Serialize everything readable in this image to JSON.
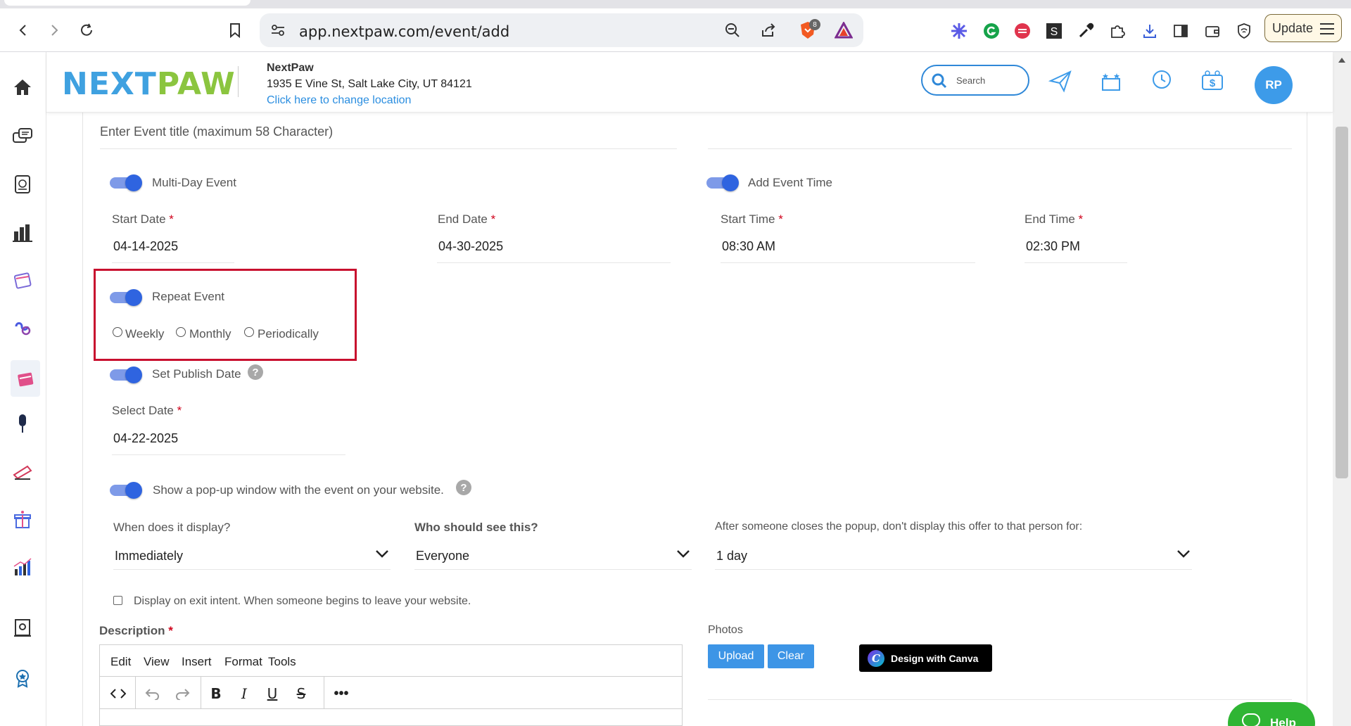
{
  "browser": {
    "url": "app.nextpaw.com/event/add",
    "update_label": "Update",
    "brave_badge": "8"
  },
  "header": {
    "logo_part1": "NEXT",
    "logo_part2": "PAW",
    "business_name": "NextPaw",
    "address": "1935 E Vine St, Salt Lake City, UT 84121",
    "change_location": "Click here to change location",
    "search_placeholder": "Search",
    "avatar_initials": "RP"
  },
  "form": {
    "title_placeholder": "Enter Event title (maximum 58 Character)",
    "multi_day_label": "Multi-Day Event",
    "add_time_label": "Add Event Time",
    "start_date_label": "Start Date",
    "start_date": "04-14-2025",
    "end_date_label": "End Date",
    "end_date": "04-30-2025",
    "start_time_label": "Start Time",
    "start_time": "08:30 AM",
    "end_time_label": "End Time",
    "end_time": "02:30 PM",
    "repeat_label": "Repeat Event",
    "repeat_options": [
      "Weekly",
      "Monthly",
      "Periodically"
    ],
    "publish_label": "Set Publish Date",
    "select_date_label": "Select Date",
    "select_date": "04-22-2025",
    "popup_label": "Show a pop-up window with the event on your website.",
    "display_when_label": "When does it display?",
    "display_when_value": "Immediately",
    "who_label": "Who should see this?",
    "who_value": "Everyone",
    "closes_label": "After someone closes the popup, don't display this offer to that person for:",
    "closes_value": "1 day",
    "exit_intent_label": "Display on exit intent. When someone begins to leave your website.",
    "description_label": "Description",
    "editor_menu": [
      "Edit",
      "View",
      "Insert",
      "Format",
      "Tools"
    ],
    "photos_label": "Photos",
    "upload_label": "Upload",
    "clear_label": "Clear",
    "canva_label": "Design with Canva",
    "required_mark": "*",
    "help_mark": "?"
  },
  "help_widget": "Help",
  "colors": {
    "accent": "#2f64e0",
    "link": "#2b8ee0",
    "logo_blue": "#3fa1e0",
    "logo_green": "#8bc53f",
    "highlight": "#c8102e"
  }
}
